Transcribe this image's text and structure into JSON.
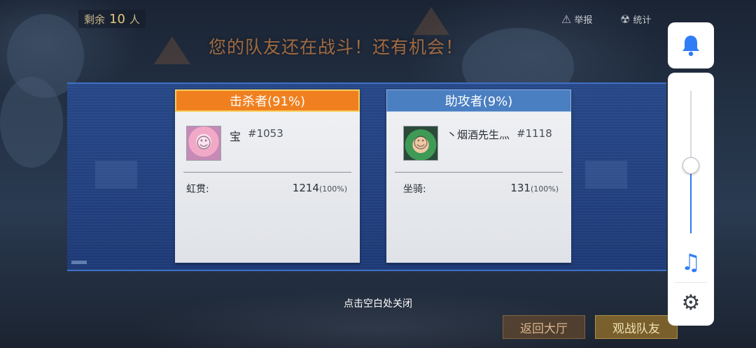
{
  "top": {
    "remaining_prefix": "剩余",
    "remaining_count": "10",
    "remaining_suffix": "人",
    "report_label": "举报",
    "stats_label": "统计",
    "headline": "您的队友还在战斗！还有机会！"
  },
  "killer_card": {
    "title": "击杀者(91%)",
    "player_name": "宝",
    "player_id": "#1053",
    "stat_label": "虹贯:",
    "stat_value": "1214",
    "stat_pct": "(100%)"
  },
  "assist_card": {
    "title": "助攻者(9%)",
    "player_name": "丶烟酒先生灬",
    "player_id": "#1118",
    "stat_label": "坐骑:",
    "stat_value": "131",
    "stat_pct": "(100%)"
  },
  "close_hint": "点击空白处关闭",
  "buttons": {
    "back_lobby": "返回大厅",
    "spectate_team": "观战队友"
  },
  "side_widget": {
    "bell_icon": "bell-icon",
    "music_icon": "music-note-icon",
    "gear_icon": "gear-icon",
    "volume_level": 0.48
  },
  "colors": {
    "killer_header": "#f0801f",
    "assist_header": "#4a7fc1",
    "accent_blue": "#2f7cf6"
  }
}
